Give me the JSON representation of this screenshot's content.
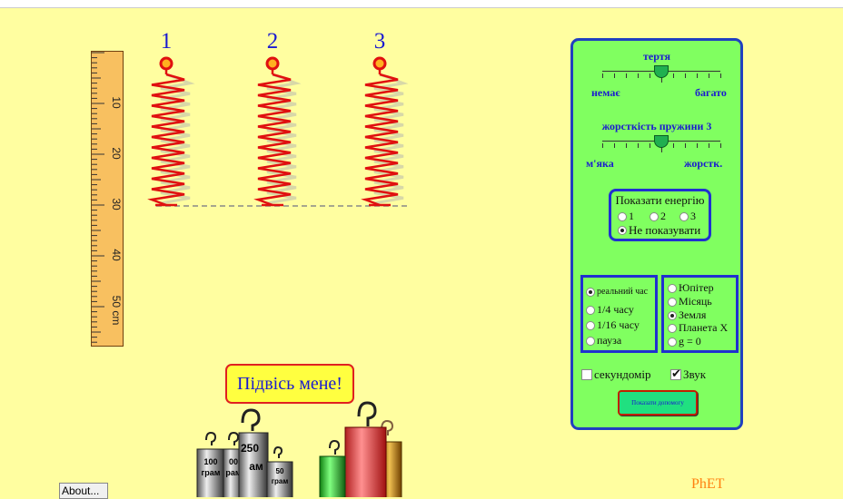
{
  "springs": {
    "labels": [
      "1",
      "2",
      "3"
    ]
  },
  "ruler": {
    "labels": [
      "10",
      "20",
      "30",
      "40",
      "50 cm"
    ]
  },
  "panel": {
    "friction": {
      "title": "тертя",
      "min_label": "немає",
      "max_label": "багато",
      "level": 0.5
    },
    "stiffness": {
      "title": "жорсткість пружини 3",
      "min_label": "м'яка",
      "max_label": "жорстк.",
      "level": 0.5
    },
    "energy": {
      "title": "Показати енергію",
      "options": [
        "1",
        "2",
        "3"
      ],
      "none_label": "Не показувати",
      "selected": "Не показувати"
    },
    "time": {
      "options": [
        "реальний час",
        "1/4 часу",
        "1/16 часу",
        "пауза"
      ],
      "selected": "реальний час"
    },
    "gravity": {
      "options": [
        "Юпітер",
        "Місяць",
        "Земля",
        "Планета X",
        "g = 0"
      ],
      "selected": "Земля"
    },
    "stopwatch_label": "секундомір",
    "sound_label": "Звук",
    "help_button": "Показати допомогу"
  },
  "hang_me": "Підвісь мене!",
  "masses": {
    "labels": [
      "100 грам",
      "100 грам",
      "250 грам",
      "50 грам"
    ]
  },
  "about_button": "About...",
  "brand": "PhET",
  "colors": {
    "background": "#fffea0",
    "panel": "#80ff60",
    "panel_border": "#2040c0",
    "spring": "#e01010",
    "numbers": "#1a1ad0",
    "phet": "#ff8010"
  }
}
